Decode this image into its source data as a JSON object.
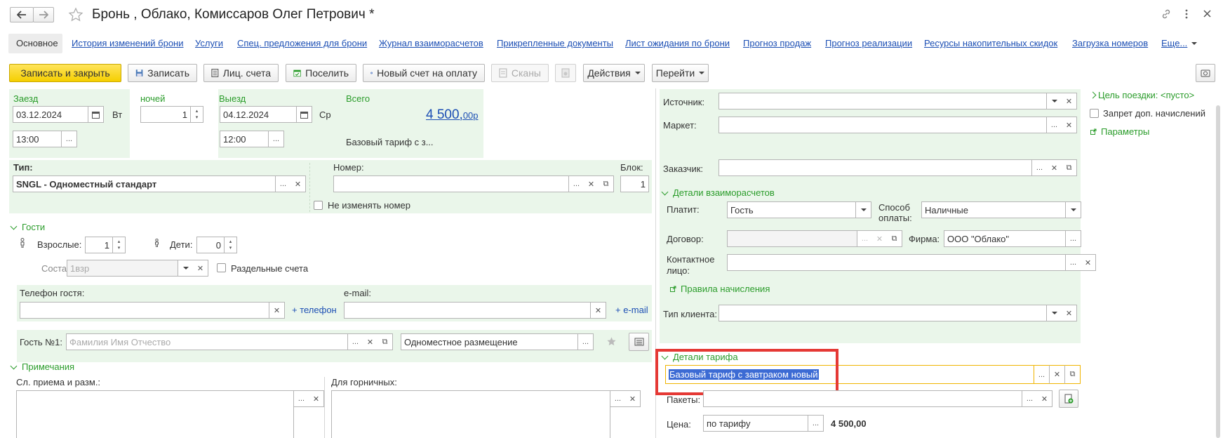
{
  "window": {
    "title": "Бронь , Облако, Комиссаров Олег Петрович *"
  },
  "tabs": [
    {
      "label": "Основное",
      "active": true
    },
    {
      "label": "История изменений брони"
    },
    {
      "label": "Услуги"
    },
    {
      "label": "Спец. предложения для брони"
    },
    {
      "label": "Журнал взаиморасчетов"
    },
    {
      "label": "Прикрепленные документы"
    },
    {
      "label": "Лист ожидания по брони"
    },
    {
      "label": "Прогноз продаж"
    },
    {
      "label": "Прогноз реализации"
    },
    {
      "label": "Ресурсы накопительных скидок"
    },
    {
      "label": "Загрузка номеров"
    },
    {
      "label": "Еще..."
    }
  ],
  "toolbar": {
    "save_close": "Записать и закрыть",
    "save": "Записать",
    "accounts": "Лиц. счета",
    "check_in": "Поселить",
    "new_invoice": "Новый счет на оплату",
    "scans": "Сканы",
    "actions": "Действия",
    "goto": "Перейти"
  },
  "stay": {
    "checkin_label": "Заезд",
    "checkin_date": "03.12.2024",
    "checkin_weekday": "Вт",
    "checkin_time": "13:00",
    "nights_label": "ночей",
    "nights": "1",
    "checkout_label": "Выезд",
    "checkout_date": "04.12.2024",
    "checkout_weekday": "Ср",
    "checkout_time": "12:00",
    "total_label": "Всего",
    "total_main": "4 500,",
    "total_cents": "00р",
    "tariff_short": "Базовый тариф с з..."
  },
  "room": {
    "type_label": "Тип:",
    "type_value": "SNGL - Одноместный стандарт",
    "number_label": "Номер:",
    "number_value": "",
    "block_label": "Блок:",
    "block_value": "1",
    "keep_number": "Не изменять номер"
  },
  "guests": {
    "section": "Гости",
    "adults_label": "Взрослые:",
    "adults": "1",
    "children_label": "Дети:",
    "children": "0",
    "composition_label": "Состав:",
    "composition_placeholder": "1взр",
    "separate_accounts": "Раздельные счета",
    "phone_label": "Телефон гостя:",
    "add_phone": "+ телефон",
    "email_label": "e-mail:",
    "add_email": "+ e-mail",
    "guest1_label": "Гость №1:",
    "guest1_placeholder": "Фамилия Имя Отчество",
    "placement": "Одноместное размещение"
  },
  "notes": {
    "section": "Примечания",
    "reception_label": "Сл. приема и разм.:",
    "maids_label": "Для горничных:"
  },
  "right": {
    "source_label": "Источник:",
    "market_label": "Маркет:",
    "customer_label": "Заказчик:",
    "settlement_section": "Детали взаиморасчетов",
    "payer_label": "Платит:",
    "payer_value": "Гость",
    "payment_method_label": "Способ оплаты:",
    "payment_method_value": "Наличные",
    "contract_label": "Договор:",
    "firm_label": "Фирма:",
    "firm_value": "ООО \"Облако\"",
    "contact_label": "Контактное лицо:",
    "charge_rules": "Правила начисления",
    "client_type_label": "Тип клиента:",
    "tariff_section": "Детали тарифа",
    "tariff_value": "Базовый тариф с завтраком новый",
    "packages_label": "Пакеты:",
    "price_label": "Цена:",
    "price_mode": "по тарифу",
    "price_value": "4 500,00"
  },
  "side": {
    "trip_purpose": "Цель поездки: <пусто>",
    "no_extra_charges": "Запрет доп. начислений",
    "parameters": "Параметры"
  },
  "colors": {
    "green": "#2a9c2a",
    "link": "#1c4fb4",
    "highlight": "#e53935",
    "primary": "#f5cf00"
  }
}
